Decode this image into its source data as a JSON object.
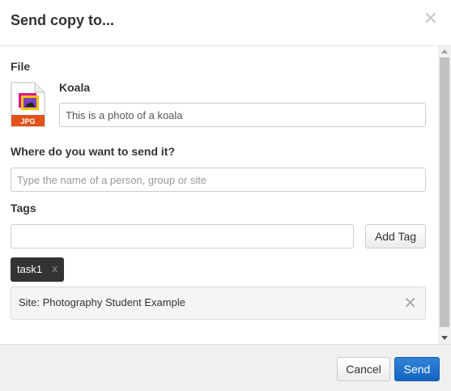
{
  "dialog": {
    "title": "Send copy to...",
    "close_glyph": "✕"
  },
  "file": {
    "section_label": "File",
    "name": "Koala",
    "icon_badge": "JPG",
    "description_value": "This is a photo of a koala"
  },
  "recipient": {
    "section_label": "Where do you want to send it?",
    "placeholder": "Type the name of a person, group or site",
    "value": ""
  },
  "tags": {
    "section_label": "Tags",
    "input_value": "",
    "add_button_label": "Add Tag",
    "items": [
      {
        "label": "task1",
        "remove_glyph": "x"
      }
    ]
  },
  "selected": {
    "site_label": "Site: Photography Student Example",
    "remove_glyph": "✕"
  },
  "footer": {
    "cancel_label": "Cancel",
    "send_label": "Send"
  },
  "colors": {
    "primary": "#1565c0",
    "chip_bg": "#333333",
    "footer_bg": "#f0f0f0"
  }
}
